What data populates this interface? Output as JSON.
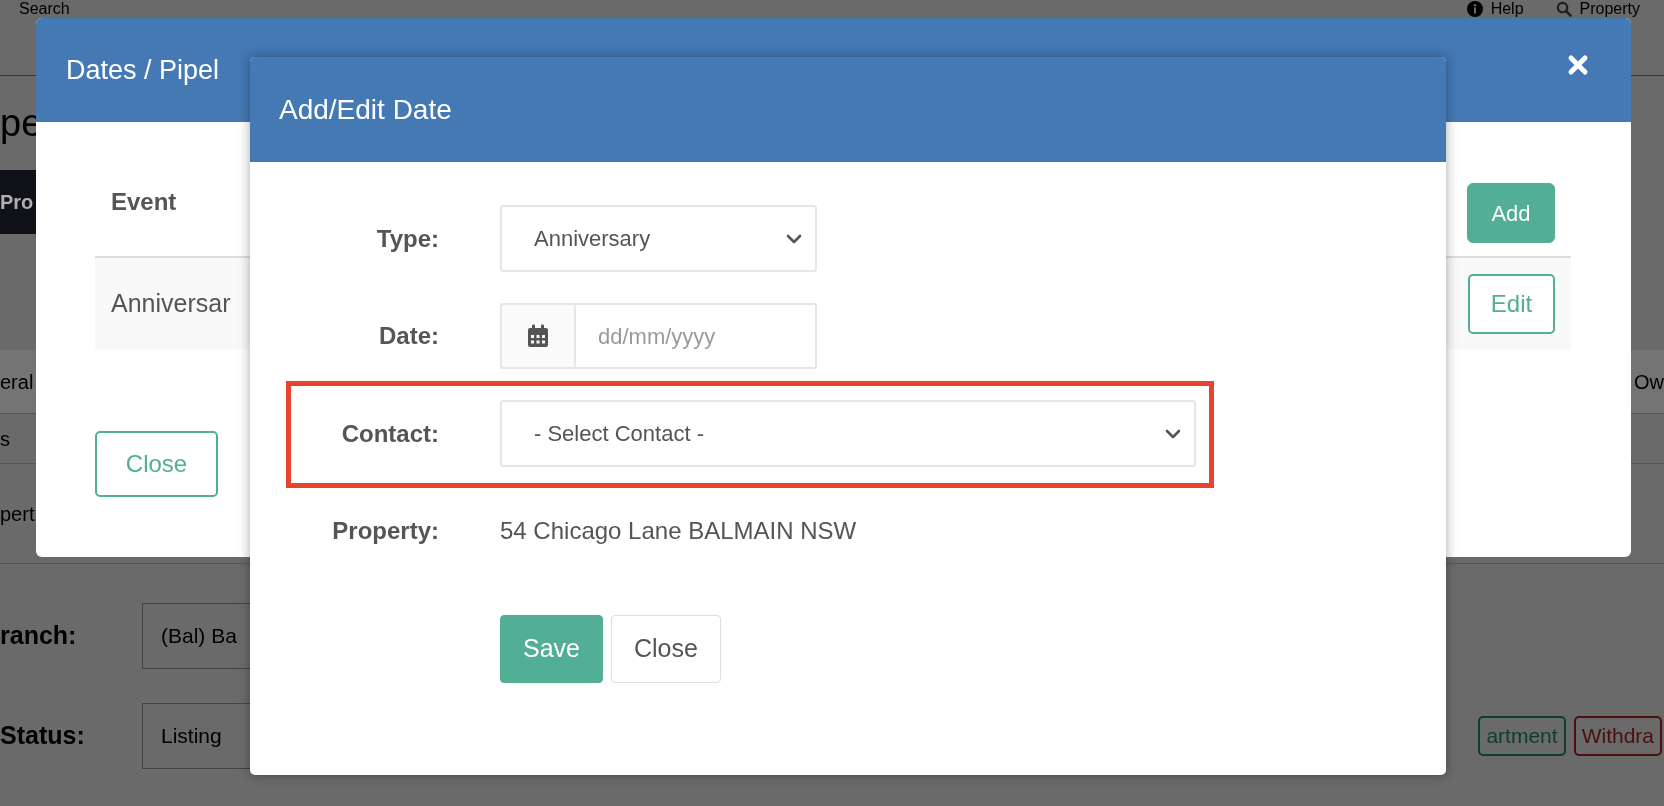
{
  "background_page": {
    "top_bar": {
      "search": "Search",
      "help": "Help",
      "property": "Property"
    },
    "heading": "pe",
    "tab_strip": "Pro",
    "rows": [
      {
        "label": "eral",
        "right": "Ow"
      },
      {
        "label": "s"
      },
      {
        "label": "pert"
      }
    ],
    "fields": [
      {
        "label": "ranch:",
        "value": "(Bal) Ba"
      },
      {
        "label": "Status:",
        "value": "Listing"
      }
    ],
    "tags": [
      {
        "label": "artment",
        "color": "#0e3d2c"
      },
      {
        "label": "Withdra",
        "color": "#4a0e13"
      }
    ]
  },
  "outer_modal": {
    "title": "Dates / Pipel",
    "table": {
      "columns": [
        "Event"
      ],
      "rows": [
        {
          "cells": [
            "Anniversar"
          ]
        }
      ]
    },
    "add_button": "Add",
    "edit_button": "Edit",
    "close_button": "Close"
  },
  "inner_modal": {
    "title": "Add/Edit Date",
    "fields": [
      {
        "kind": "select",
        "label": "Type:",
        "value": "Anniversary",
        "highlighted": false
      },
      {
        "kind": "date",
        "label": "Date:",
        "placeholder": "dd/mm/yyyy",
        "highlighted": false
      },
      {
        "kind": "select",
        "label": "Contact:",
        "value": "- Select Contact -",
        "highlighted": true
      },
      {
        "kind": "text",
        "label": "Property:",
        "value": "54 Chicago Lane BALMAIN NSW",
        "highlighted": false
      }
    ],
    "buttons": [
      {
        "kind": "primary",
        "label": "Save"
      },
      {
        "kind": "secondary",
        "label": "Close"
      }
    ]
  }
}
